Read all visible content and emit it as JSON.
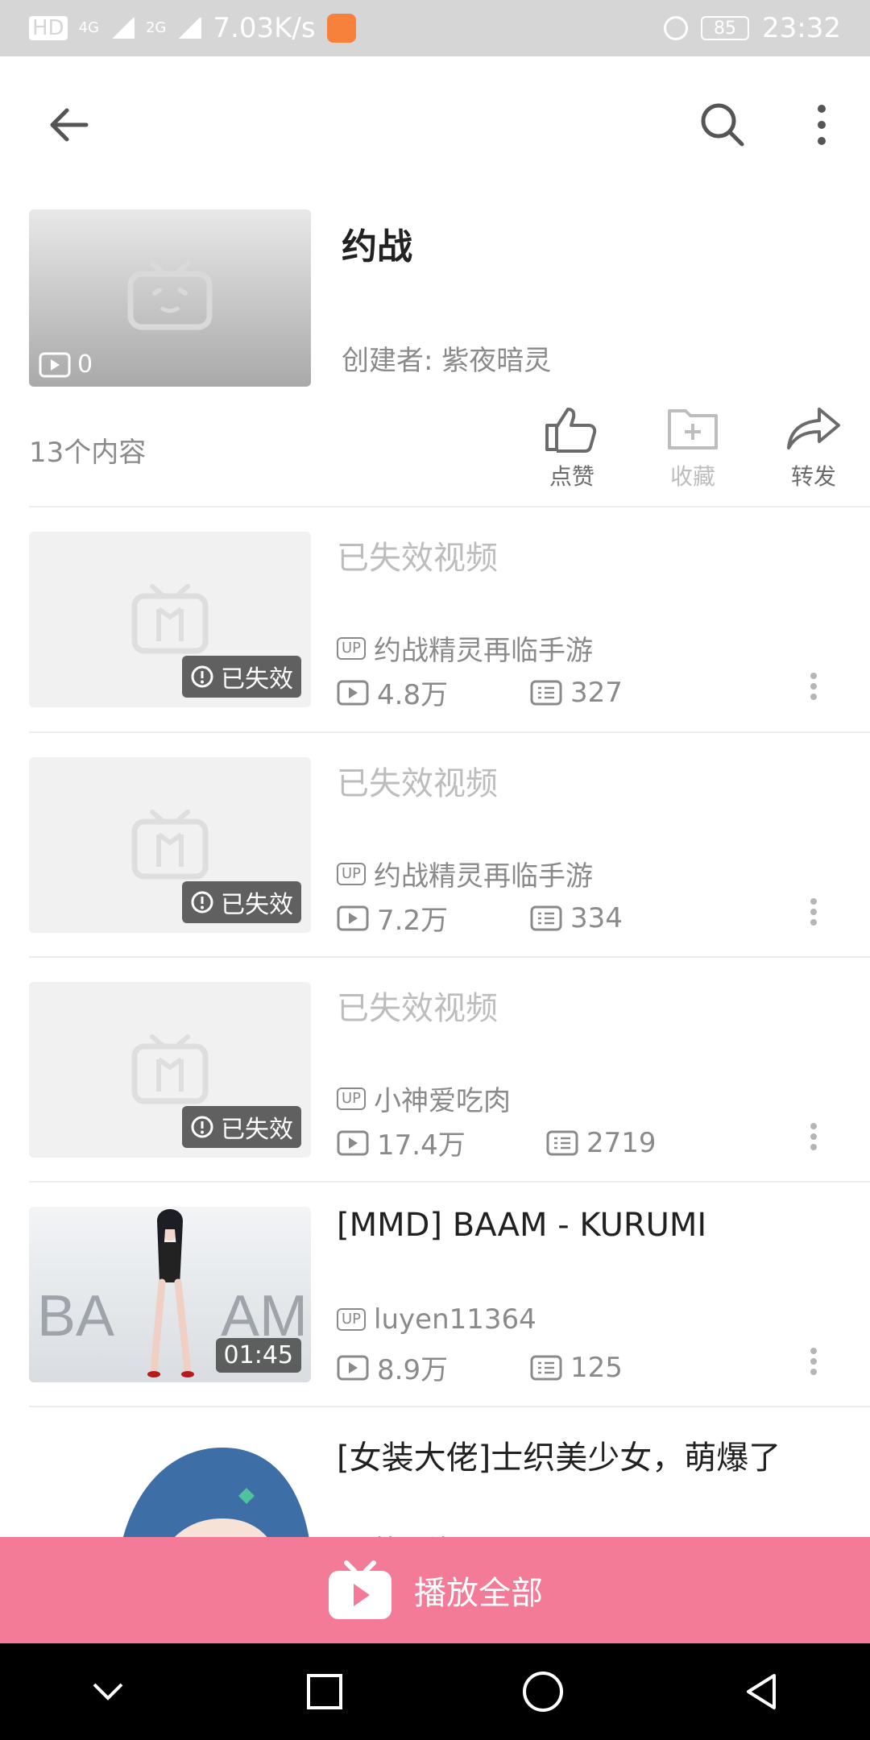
{
  "status_bar": {
    "network_left": "HD",
    "net1": "4G",
    "net2": "2G",
    "speed": "7.03K/s",
    "battery": "85",
    "time": "23:32"
  },
  "playlist": {
    "title": "约战",
    "creator": "创建者: 紫夜暗灵",
    "video_count_badge": "0",
    "content_count": "13个内容"
  },
  "actions": {
    "like": "点赞",
    "favorite": "收藏",
    "share": "转发"
  },
  "items": [
    {
      "title": "已失效视频",
      "badge": "已失效",
      "up": "约战精灵再临手游",
      "plays": "4.8万",
      "danmaku": "327"
    },
    {
      "title": "已失效视频",
      "badge": "已失效",
      "up": "约战精灵再临手游",
      "plays": "7.2万",
      "danmaku": "334"
    },
    {
      "title": "已失效视频",
      "badge": "已失效",
      "up": "小神爱吃肉",
      "plays": "17.4万",
      "danmaku": "2719"
    },
    {
      "title": "[MMD] BAAM - KURUMI",
      "badge": "01:45",
      "up": "luyen11364",
      "plays": "8.9万",
      "danmaku": "125",
      "thumb_text_left": "BA",
      "thumb_text_right": "AM"
    },
    {
      "title": "[女装大佬]士织美少女，萌爆了",
      "up": "筱栗泷刃"
    }
  ],
  "up_label": "UP",
  "play_all": "播放全部",
  "colors": {
    "accent": "#f37b97",
    "status_bar": "#d6d6d6"
  }
}
